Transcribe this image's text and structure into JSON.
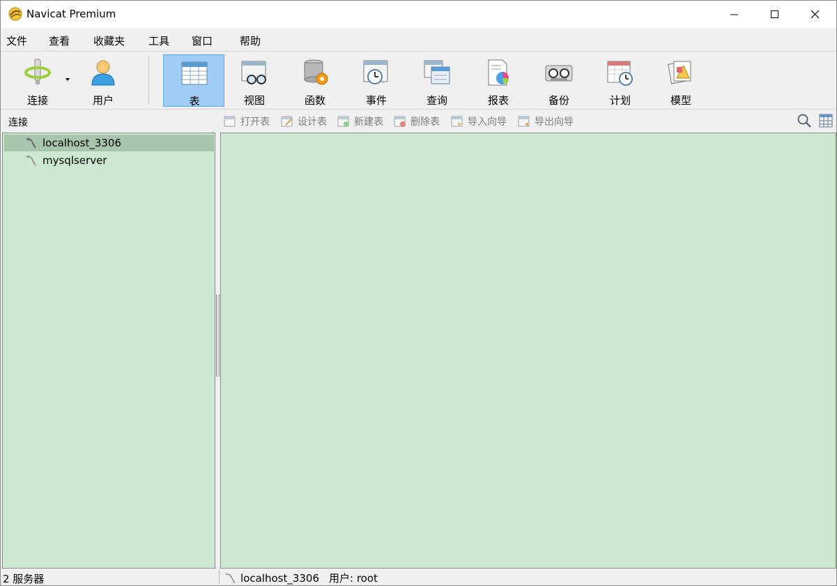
{
  "window": {
    "title": "Navicat Premium"
  },
  "menu": [
    "文件",
    "查看",
    "收藏夹",
    "工具",
    "窗口",
    "帮助"
  ],
  "toolbar": {
    "items": [
      {
        "label": "连接",
        "icon": "connection-icon"
      },
      {
        "label": "用户",
        "icon": "user-icon"
      },
      {
        "label": "表",
        "icon": "table-icon",
        "active": true
      },
      {
        "label": "视图",
        "icon": "view-icon"
      },
      {
        "label": "函数",
        "icon": "function-icon"
      },
      {
        "label": "事件",
        "icon": "event-icon"
      },
      {
        "label": "查询",
        "icon": "query-icon"
      },
      {
        "label": "报表",
        "icon": "report-icon"
      },
      {
        "label": "备份",
        "icon": "backup-icon"
      },
      {
        "label": "计划",
        "icon": "schedule-icon"
      },
      {
        "label": "模型",
        "icon": "model-icon"
      }
    ]
  },
  "connections_header": "连接",
  "object_toolbar": [
    "打开表",
    "设计表",
    "新建表",
    "删除表",
    "导入向导",
    "导出向导"
  ],
  "tree": [
    {
      "label": "localhost_3306",
      "selected": true
    },
    {
      "label": "mysqlserver",
      "selected": false
    }
  ],
  "status": {
    "left": "2 服务器",
    "connection": "localhost_3306",
    "user": "用户: root"
  },
  "colors": {
    "panel_bg": "#cde8d0",
    "selected_row": "#a7c6ac",
    "active_tool": "#9fcdf5"
  }
}
